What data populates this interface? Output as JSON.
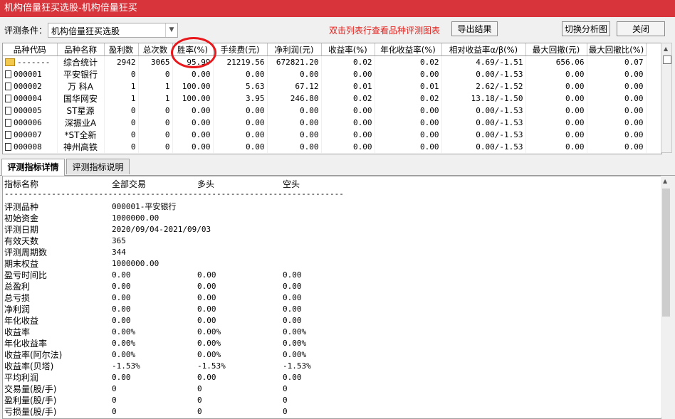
{
  "window": {
    "title": "机构倍量狂买选股-机构倍量狂买"
  },
  "toolbar": {
    "condition_label": "评测条件：",
    "condition_value": "机构倍量狂买选股",
    "hint": "双击列表行查看品种评测图表",
    "export_label": "导出结果",
    "switch_label": "切换分析图",
    "close_label": "关闭"
  },
  "grid": {
    "columns": [
      "品种代码",
      "品种名称",
      "盈利数",
      "总次数",
      "胜率(%)",
      "手续费(元)",
      "净利润(元)",
      "收益率(%)",
      "年化收益率(%)",
      "相对收益率α/β(%)",
      "最大回撤(元)",
      "最大回撤比(%)"
    ],
    "rows": [
      {
        "code": "-------",
        "name": "综合统计",
        "win": "2942",
        "total": "3065",
        "rate": "95.99",
        "fee": "21219.56",
        "profit": "672821.20",
        "ret": "0.02",
        "annual": "0.02",
        "rel": "4.69/-1.51",
        "maxdd": "656.06",
        "ddratio": "0.07",
        "icon": "summary"
      },
      {
        "code": "000001",
        "name": "平安银行",
        "win": "0",
        "total": "0",
        "rate": "0.00",
        "fee": "0.00",
        "profit": "0.00",
        "ret": "0.00",
        "annual": "0.00",
        "rel": "0.00/-1.53",
        "maxdd": "0.00",
        "ddratio": "0.00",
        "icon": "doc"
      },
      {
        "code": "000002",
        "name": "万 科A",
        "win": "1",
        "total": "1",
        "rate": "100.00",
        "fee": "5.63",
        "profit": "67.12",
        "ret": "0.01",
        "annual": "0.01",
        "rel": "2.62/-1.52",
        "maxdd": "0.00",
        "ddratio": "0.00",
        "icon": "doc"
      },
      {
        "code": "000004",
        "name": "国华网安",
        "win": "1",
        "total": "1",
        "rate": "100.00",
        "fee": "3.95",
        "profit": "246.80",
        "ret": "0.02",
        "annual": "0.02",
        "rel": "13.18/-1.50",
        "maxdd": "0.00",
        "ddratio": "0.00",
        "icon": "doc"
      },
      {
        "code": "000005",
        "name": "ST星源",
        "win": "0",
        "total": "0",
        "rate": "0.00",
        "fee": "0.00",
        "profit": "0.00",
        "ret": "0.00",
        "annual": "0.00",
        "rel": "0.00/-1.53",
        "maxdd": "0.00",
        "ddratio": "0.00",
        "icon": "doc"
      },
      {
        "code": "000006",
        "name": "深振业A",
        "win": "0",
        "total": "0",
        "rate": "0.00",
        "fee": "0.00",
        "profit": "0.00",
        "ret": "0.00",
        "annual": "0.00",
        "rel": "0.00/-1.53",
        "maxdd": "0.00",
        "ddratio": "0.00",
        "icon": "doc"
      },
      {
        "code": "000007",
        "name": "*ST全新",
        "win": "0",
        "total": "0",
        "rate": "0.00",
        "fee": "0.00",
        "profit": "0.00",
        "ret": "0.00",
        "annual": "0.00",
        "rel": "0.00/-1.53",
        "maxdd": "0.00",
        "ddratio": "0.00",
        "icon": "doc"
      },
      {
        "code": "000008",
        "name": "神州高铁",
        "win": "0",
        "total": "0",
        "rate": "0.00",
        "fee": "0.00",
        "profit": "0.00",
        "ret": "0.00",
        "annual": "0.00",
        "rel": "0.00/-1.53",
        "maxdd": "0.00",
        "ddratio": "0.00",
        "icon": "doc"
      }
    ]
  },
  "tabs": [
    {
      "label": "评测指标详情",
      "active": true
    },
    {
      "label": "评测指标说明",
      "active": false
    }
  ],
  "detail": {
    "headers": [
      "指标名称",
      "全部交易",
      "多头",
      "空头"
    ],
    "separator": "------------------------------------------------------------------------",
    "rows": [
      {
        "name": "评测品种",
        "all": "000001-平安银行",
        "long": "",
        "short": ""
      },
      {
        "name": "初始资金",
        "all": "1000000.00",
        "long": "",
        "short": ""
      },
      {
        "name": "评测日期",
        "all": "2020/09/04-2021/09/03",
        "long": "",
        "short": ""
      },
      {
        "name": "有效天数",
        "all": "365",
        "long": "",
        "short": ""
      },
      {
        "name": "评测周期数",
        "all": "344",
        "long": "",
        "short": ""
      },
      {
        "name": "期末权益",
        "all": "1000000.00",
        "long": "",
        "short": ""
      },
      {
        "name": "盈亏时间比",
        "all": "0.00",
        "long": "0.00",
        "short": "0.00"
      },
      {
        "name": "总盈利",
        "all": "0.00",
        "long": "0.00",
        "short": "0.00"
      },
      {
        "name": "总亏损",
        "all": "0.00",
        "long": "0.00",
        "short": "0.00"
      },
      {
        "name": "净利润",
        "all": "0.00",
        "long": "0.00",
        "short": "0.00"
      },
      {
        "name": "年化收益",
        "all": "0.00",
        "long": "0.00",
        "short": "0.00"
      },
      {
        "name": "收益率",
        "all": "0.00%",
        "long": "0.00%",
        "short": "0.00%"
      },
      {
        "name": "年化收益率",
        "all": "0.00%",
        "long": "0.00%",
        "short": "0.00%"
      },
      {
        "name": "收益率(阿尔法)",
        "all": "0.00%",
        "long": "0.00%",
        "short": "0.00%"
      },
      {
        "name": "收益率(贝塔)",
        "all": "-1.53%",
        "long": "-1.53%",
        "short": "-1.53%"
      },
      {
        "name": "平均利润",
        "all": "0.00",
        "long": "0.00",
        "short": "0.00"
      },
      {
        "name": "交易量(股/手)",
        "all": "0",
        "long": "0",
        "short": "0"
      },
      {
        "name": "盈利量(股/手)",
        "all": "0",
        "long": "0",
        "short": "0"
      },
      {
        "name": "亏损量(股/手)",
        "all": "0",
        "long": "0",
        "short": "0"
      }
    ]
  },
  "colors": {
    "titlebar": "#d7343b",
    "hint": "#e2211c",
    "highlight_circle": "#e8191d"
  }
}
